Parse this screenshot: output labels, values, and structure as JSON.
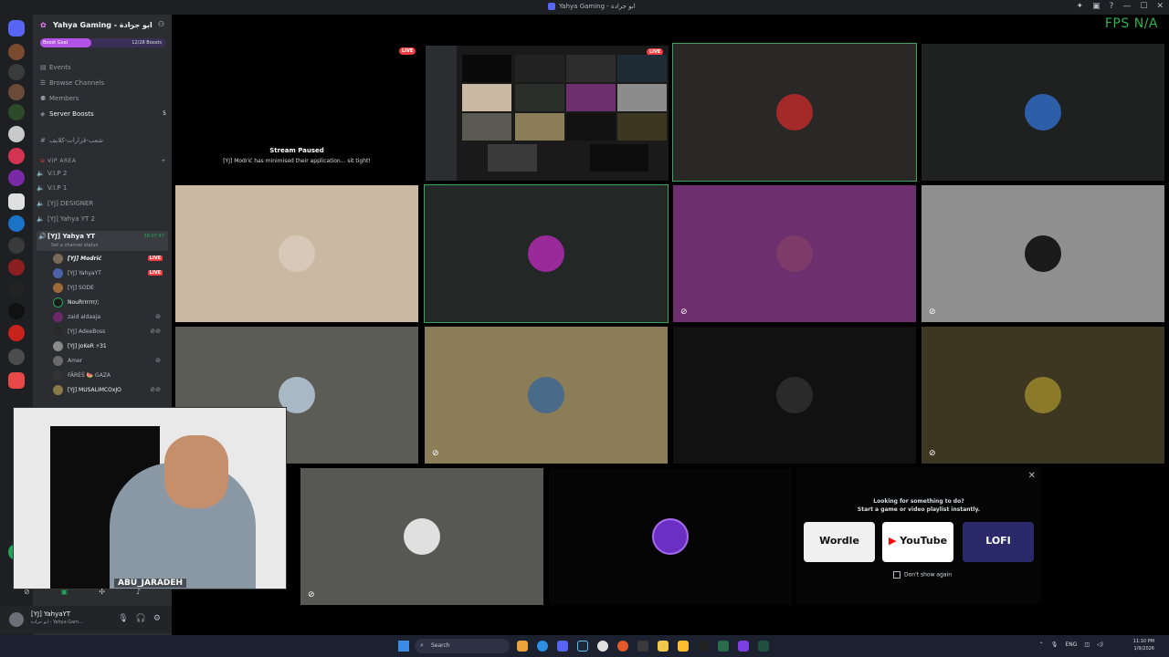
{
  "window": {
    "title": "Yahya Gaming - ابو جرادة",
    "fps_label": "FPS",
    "fps_value": "N/A"
  },
  "server": {
    "name": "Yahya Gaming - ابو جرادة",
    "boost_goal": "Boost Goal",
    "boost_count": "12/28 Boosts",
    "menu": [
      {
        "label": "Events",
        "icon": "calendar-icon"
      },
      {
        "label": "Browse Channels",
        "icon": "list-icon"
      },
      {
        "label": "Members",
        "icon": "members-icon"
      },
      {
        "label": "Server Boosts",
        "icon": "boost-icon",
        "badge": "5"
      }
    ],
    "category_1": "شعب-قرارات-كلايف",
    "category_2": "VIP AREA",
    "voice_channels": [
      "V.I.P 2",
      "V.I.P 1",
      "[YJ] DESIGNER",
      "[YJ] Yahya YT 2"
    ],
    "active_channel": {
      "name": "[YJ] Yahya YT",
      "status": "Set a channel status",
      "timer": "38:07:47"
    },
    "members": [
      {
        "name": "[YJ] Modrić",
        "live": "LIVE"
      },
      {
        "name": "[YJ] YahyaYT",
        "live": "LIVE"
      },
      {
        "name": "[YJ] SODE"
      },
      {
        "name": "NouRrrrrrr/;"
      },
      {
        "name": "zaid aldaaja"
      },
      {
        "name": "[YJ] AdeeBoss"
      },
      {
        "name": "[YJ] JoKeR ⚡31"
      },
      {
        "name": "Amer"
      },
      {
        "name": "FÂRÈŚ 🍉 GAZA"
      },
      {
        "name": "[YJ] MUSALIMCOxJO"
      }
    ]
  },
  "user": {
    "name": "[YJ] YahyaYT",
    "status": "ابو جرادة - Yahya Gam..."
  },
  "grid": {
    "live_label": "LIVE",
    "paused_title": "Stream Paused",
    "paused_msg": "[YJ] Modrić has minimised their application... sit tight!"
  },
  "webcam": {
    "name": "ABU_JARADEH"
  },
  "activity": {
    "line1": "Looking for something to do?",
    "line2": "Start a game or video playlist instantly.",
    "cards": [
      "Wordle",
      "YouTube",
      "LOFI"
    ],
    "dont_show": "Don't show again"
  },
  "taskbar": {
    "search": "Search",
    "lang": "ENG",
    "time": "11:10 PM",
    "date": "1/9/2026"
  }
}
